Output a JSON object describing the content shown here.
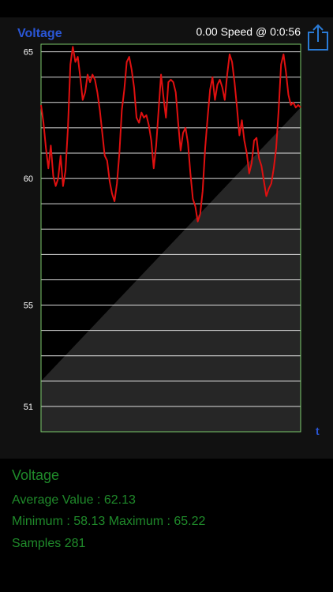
{
  "header": {
    "title": "Voltage",
    "speed_readout": "0.00 Speed @ 0:0:56",
    "share_icon": "share-icon"
  },
  "colors": {
    "title_blue": "#2a56d6",
    "line_red": "#e01010",
    "grid_white": "#ffffff",
    "frame_green": "#7bc96a",
    "stats_green": "#1f8a2a",
    "plot_gray": "#262626"
  },
  "chart_data": {
    "type": "line",
    "title": "Voltage",
    "xlabel": "t",
    "ylabel": "",
    "ylim": [
      50,
      65.3
    ],
    "y_ticks": [
      65,
      60,
      55,
      51
    ],
    "y_tick_labels": [
      "65",
      "60",
      "55",
      "51"
    ],
    "grid_values": [
      65,
      64,
      63,
      62,
      61,
      60,
      59,
      58,
      57,
      56,
      55,
      54,
      53,
      52,
      51
    ],
    "grid": true,
    "series": [
      {
        "values": [
          62.9,
          62.2,
          61.2,
          60.4,
          61.3,
          60.1,
          59.7,
          60.0,
          60.9,
          59.7,
          60.3,
          62.0,
          64.5,
          65.2,
          64.6,
          64.8,
          64.0,
          63.1,
          63.4,
          64.1,
          63.8,
          64.1,
          63.9,
          63.4,
          62.7,
          61.8,
          60.9,
          60.7,
          59.9,
          59.4,
          59.1,
          59.8,
          61.0,
          62.7,
          63.5,
          64.6,
          64.8,
          64.3,
          63.6,
          62.4,
          62.2,
          62.6,
          62.4,
          62.5,
          62.1,
          61.5,
          60.4,
          61.3,
          62.7,
          64.1,
          63.2,
          62.4,
          63.8,
          63.9,
          63.8,
          63.4,
          62.2,
          61.1,
          61.8,
          62.0,
          61.4,
          60.2,
          59.2,
          58.9,
          58.3,
          58.6,
          59.5,
          61.2,
          62.4,
          63.5,
          64.0,
          63.1,
          63.7,
          63.9,
          63.6,
          63.1,
          64.1,
          64.9,
          64.6,
          63.8,
          62.8,
          61.7,
          62.3,
          61.5,
          61.0,
          60.2,
          60.6,
          61.5,
          61.6,
          60.8,
          60.5,
          59.9,
          59.3,
          59.6,
          59.8,
          60.4,
          61.2,
          62.7,
          64.5,
          64.9,
          64.2,
          63.3,
          62.9,
          63.0,
          62.8,
          62.9,
          62.8
        ]
      }
    ]
  },
  "stats": {
    "title": "Voltage",
    "average": "Average Value : 62.13",
    "min_max": "Minimum : 58.13 Maximum : 65.22",
    "samples": "Samples 281"
  }
}
